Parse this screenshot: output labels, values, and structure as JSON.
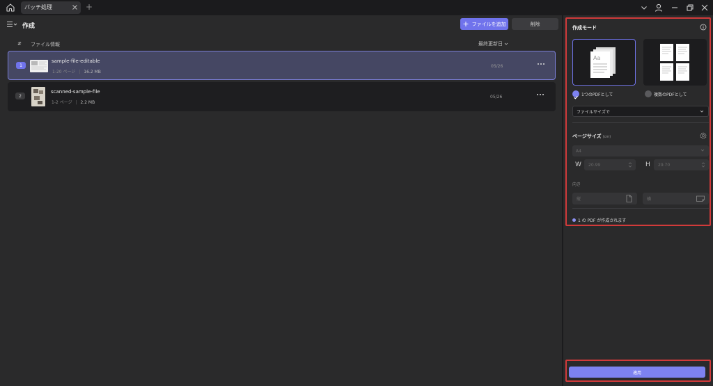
{
  "titlebar": {
    "tab_label": "バッチ処理",
    "add_tab_label": "+"
  },
  "header": {
    "title": "作成",
    "add_file_label": "ファイルを追加",
    "delete_label": "削除"
  },
  "table": {
    "col_number": "#",
    "col_file_info": "ファイル情報",
    "col_last_updated": "最終更新日"
  },
  "files": [
    {
      "index": "1",
      "name": "sample-file-editable",
      "pages": "1-20 ページ",
      "size": "16.2 MB",
      "date": "05/26"
    },
    {
      "index": "2",
      "name": "scanned-sample-file",
      "pages": "1-2 ページ",
      "size": "2.2 MB",
      "date": "05/26"
    }
  ],
  "panel": {
    "mode_title": "作成モード",
    "option_single": "1つのPDFとして",
    "option_multiple": "複数のPDFとして",
    "merge_mode": "ファイルサイズで",
    "page_size_title": "ページサイズ",
    "page_size_unit": "(cm)",
    "paper_value": "A4",
    "width_letter": "W",
    "width_value": "20.99",
    "height_letter": "H",
    "height_value": "29.70",
    "orientation_label": "向き",
    "portrait_label": "縦",
    "landscape_label": "横",
    "result_text": "1 の PDF が作成されます",
    "apply_label": "適用"
  },
  "colors": {
    "accent": "#7073ec",
    "highlight_border": "#d23a3a",
    "selected_row": "#454763"
  }
}
